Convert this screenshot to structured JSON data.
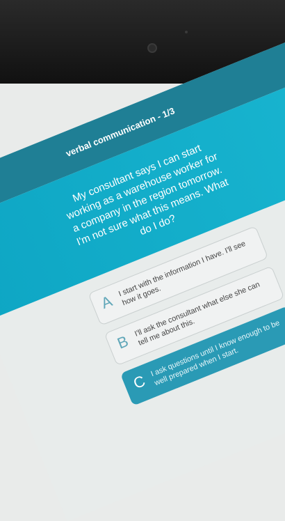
{
  "quiz": {
    "title": "verbal communication - 1/3",
    "question": "My consultant says I can start working as a warehouse worker for a company in the region tomorrow. I'm not sure what this means. What do I do?",
    "answers": [
      {
        "letter": "A",
        "text": "I start with the information I have. I'll see how it goes."
      },
      {
        "letter": "B",
        "text": "I'll ask the consultant what else she can tell me about this."
      },
      {
        "letter": "C",
        "text": "I ask questions until I know enough to be well prepared when I start."
      }
    ],
    "selected": "C"
  },
  "colors": {
    "header": "#1f7f95",
    "question_band": "#0ea6c4",
    "selected_answer": "#2a9ab5",
    "bezel": "#141414"
  }
}
